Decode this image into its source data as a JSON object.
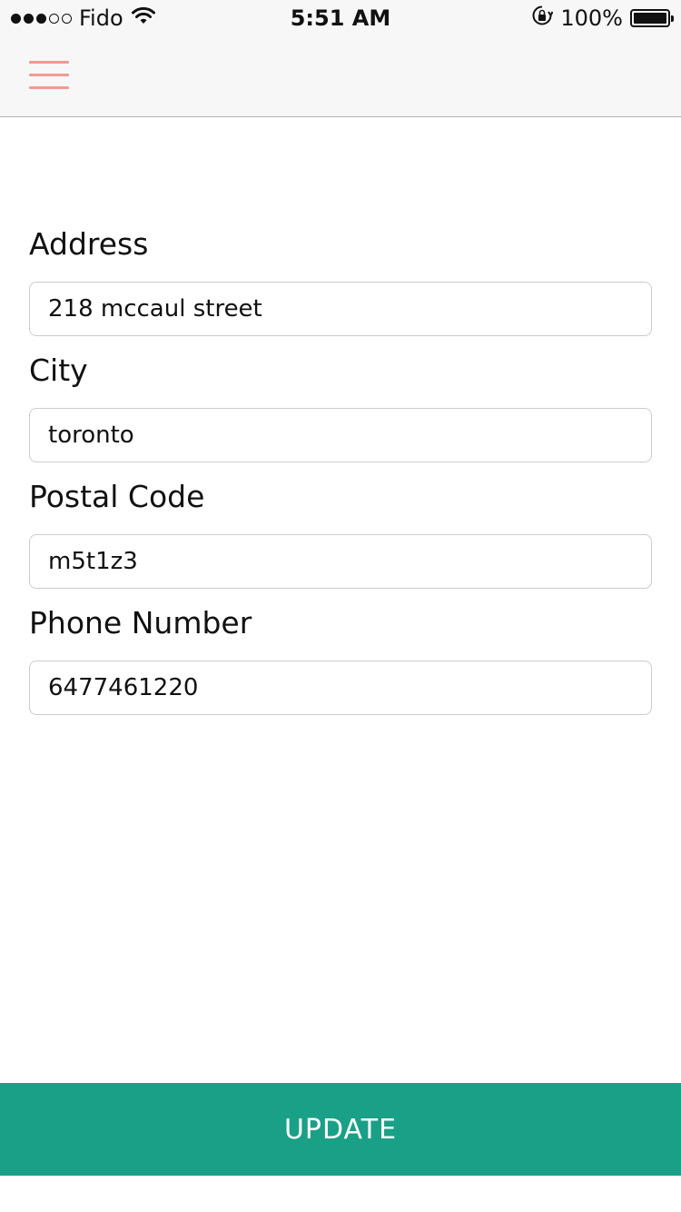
{
  "status_bar": {
    "carrier": "Fido",
    "time": "5:51 AM",
    "battery_text": "100%",
    "signal_filled": 3,
    "signal_total": 5
  },
  "nav": {
    "menu_icon": "hamburger-menu-icon",
    "menu_color": "#f19a90"
  },
  "form": {
    "address": {
      "label": "Address",
      "value": "218 mccaul street"
    },
    "city": {
      "label": "City",
      "value": "toronto"
    },
    "postal_code": {
      "label": "Postal Code",
      "value": "m5t1z3"
    },
    "phone": {
      "label": "Phone Number",
      "value": "6477461220"
    }
  },
  "actions": {
    "update_label": "UPDATE",
    "update_color": "#1aa087"
  }
}
